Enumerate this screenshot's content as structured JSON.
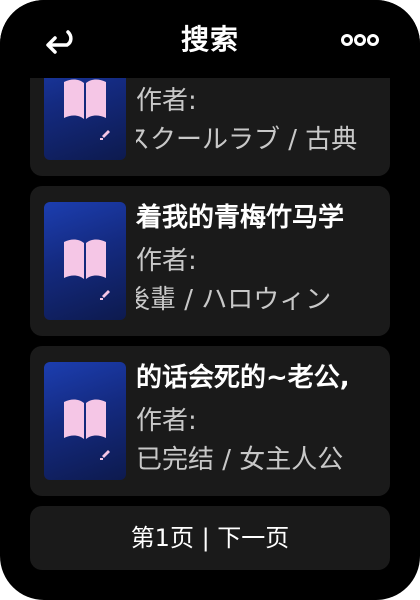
{
  "header": {
    "title": "搜索",
    "back_icon": "back-arrow-icon",
    "more_icon": "more-dots-icon"
  },
  "results": [
    {
      "title": "",
      "author_label": "作者:",
      "author": "スクールラブ / 古典",
      "cover_icon": "book-icon"
    },
    {
      "title": "着我的青梅竹马学",
      "author_label": "作者:",
      "author": "後輩 / ハロウィン",
      "cover_icon": "book-icon"
    },
    {
      "title": "的话会死的~老公,",
      "author_label": "作者:",
      "author": "已完结 / 女主人公",
      "cover_icon": "book-icon"
    }
  ],
  "pager": {
    "label": "第1页 | 下一页"
  },
  "colors": {
    "background": "#000000",
    "card": "#1a1a1a",
    "cover_top": "#1c3eb0",
    "cover_bottom": "#0d1a4e",
    "book_icon": "#f5c6e6",
    "text_primary": "#ffffff",
    "text_secondary": "#c8c8c8"
  }
}
